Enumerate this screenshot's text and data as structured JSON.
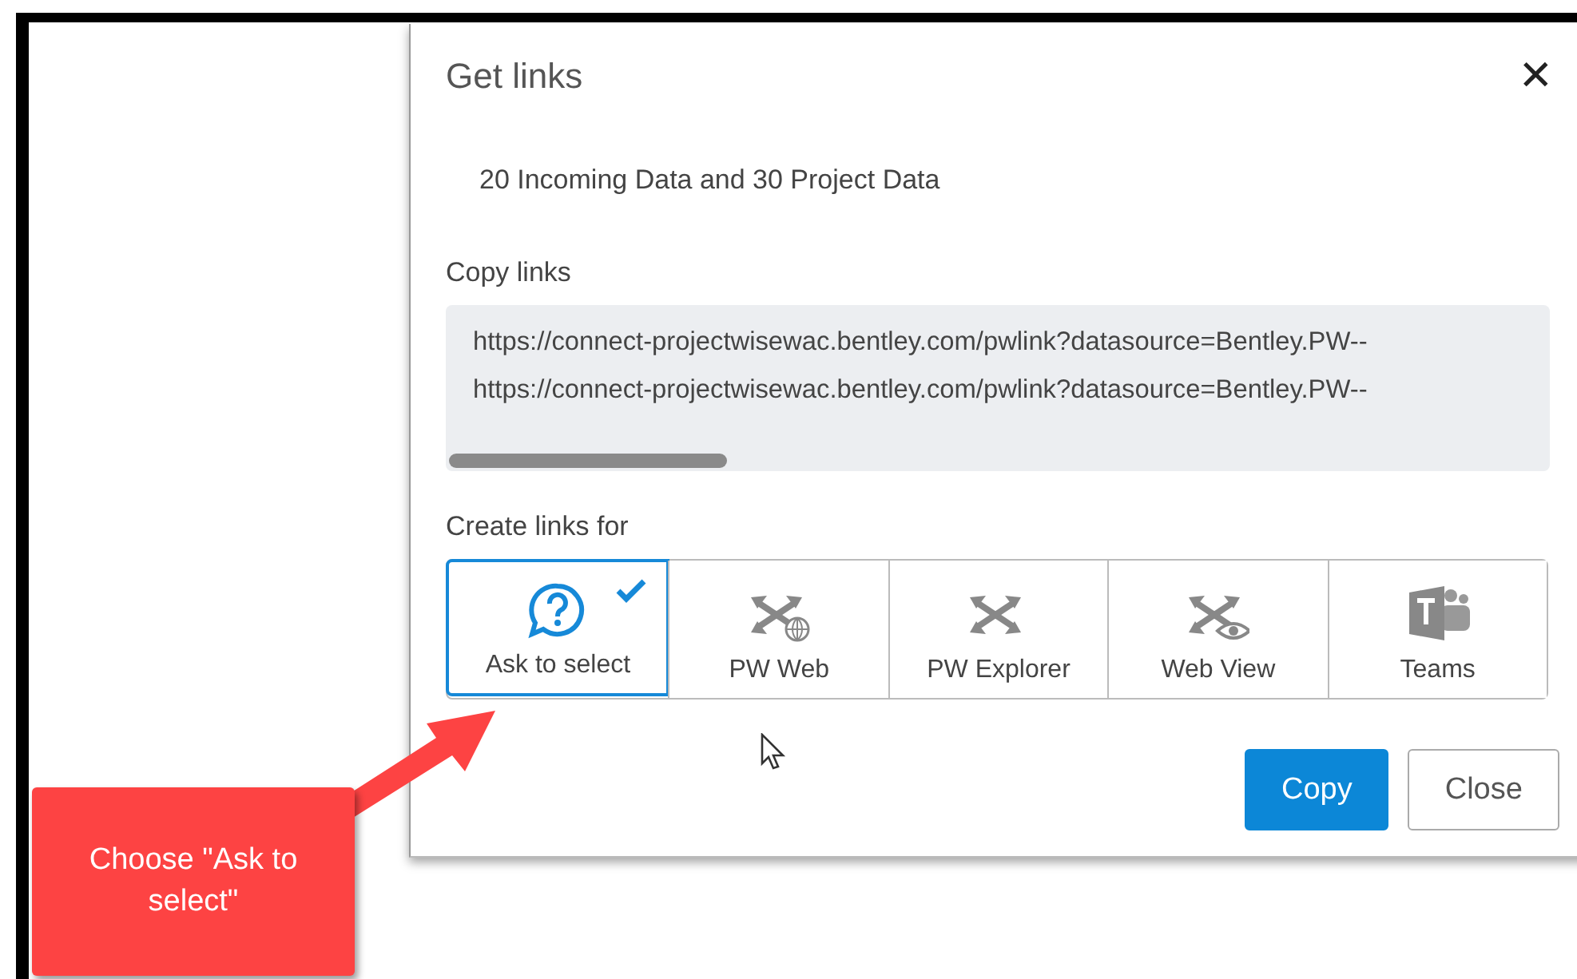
{
  "dialog": {
    "title": "Get links",
    "close_label": "✕",
    "summary": "20 Incoming Data and 30 Project Data",
    "copy_links": {
      "label": "Copy links",
      "links": [
        "https://connect-projectwisewac.bentley.com/pwlink?datasource=Bentley.PW--",
        "https://connect-projectwisewac.bentley.com/pwlink?datasource=Bentley.PW--"
      ]
    },
    "create_links_for": {
      "label": "Create links for",
      "options": [
        {
          "label": "Ask to select",
          "kind": "ask",
          "selected": true
        },
        {
          "label": "PW Web",
          "kind": "web",
          "selected": false
        },
        {
          "label": "PW Explorer",
          "kind": "explorer",
          "selected": false
        },
        {
          "label": "Web View",
          "kind": "view",
          "selected": false
        },
        {
          "label": "Teams",
          "kind": "teams",
          "selected": false
        }
      ]
    },
    "buttons": [
      {
        "label": "Copy",
        "kind": "primary"
      },
      {
        "label": "Close",
        "kind": "secondary"
      }
    ]
  },
  "callout": {
    "text": "Choose \"Ask to select\""
  }
}
